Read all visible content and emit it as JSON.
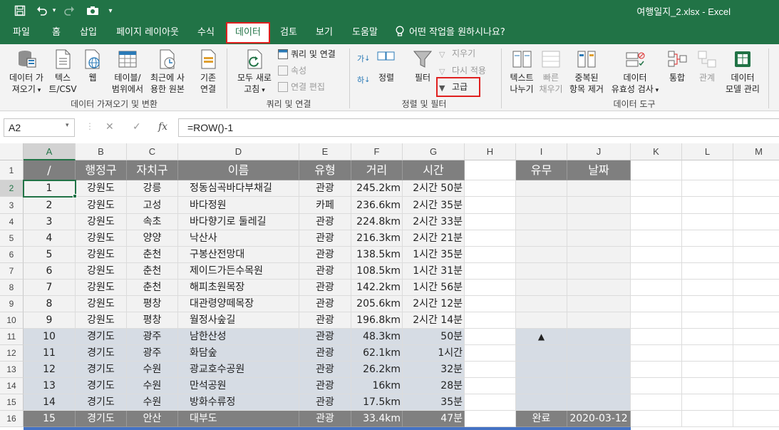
{
  "title_bar": {
    "window_title": "여행일지_2.xlsx  -  Excel"
  },
  "tabs": [
    "파일",
    "홈",
    "삽입",
    "페이지 레이아웃",
    "수식",
    "데이터",
    "검토",
    "보기",
    "도움말"
  ],
  "tell_me": "어떤 작업을 원하시나요?",
  "ribbon": {
    "get_data": {
      "data_btn": [
        "데이터 가",
        "져오기"
      ],
      "text_csv": [
        "텍스",
        "트/CSV"
      ],
      "web": "웹",
      "from_table": [
        "테이블/",
        "범위에서"
      ],
      "recent": [
        "최근에 사",
        "용한 원본"
      ],
      "existing": [
        "기존",
        "연결"
      ],
      "group": "데이터 가져오기 및 변환"
    },
    "queries": {
      "refresh": [
        "모두 새로",
        "고침"
      ],
      "queries_conn": "쿼리 및 연결",
      "properties": "속성",
      "edit_links": "연결 편집",
      "group": "쿼리 및 연결"
    },
    "sort_filter": {
      "sort": "정렬",
      "filter": "필터",
      "clear": "지우기",
      "reapply": "다시 적용",
      "advanced": "고급",
      "group": "정렬 및 필터",
      "az": "가",
      "za": "하"
    },
    "data_tools": {
      "text_to_cols": [
        "텍스트",
        "나누기"
      ],
      "flash_fill": [
        "빠른",
        "채우기"
      ],
      "remove_dup": [
        "중복된",
        "항목 제거"
      ],
      "validation": [
        "데이터",
        "유효성 검사"
      ],
      "consolidate": "통합",
      "relationships": "관계",
      "data_model": [
        "데이터",
        "모델 관리"
      ],
      "group": "데이터 도구"
    }
  },
  "formula_bar": {
    "name_box": "A2",
    "formula": "=ROW()-1",
    "fx": "fx"
  },
  "columns": [
    "A",
    "B",
    "C",
    "D",
    "E",
    "F",
    "G",
    "H",
    "I",
    "J",
    "K",
    "L",
    "M"
  ],
  "header_row": [
    "/",
    "행정구",
    "자치구",
    "이름",
    "유형",
    "거리",
    "시간",
    "",
    "유무",
    "날짜"
  ],
  "rows": [
    [
      "1",
      "강원도",
      "강릉",
      "정동심곡바다부채길",
      "관광",
      "245.2km",
      "2시간 50분",
      "",
      "",
      ""
    ],
    [
      "2",
      "강원도",
      "고성",
      "바다정원",
      "카페",
      "236.6km",
      "2시간 35분",
      "",
      "",
      ""
    ],
    [
      "3",
      "강원도",
      "속초",
      "바다향기로 둘레길",
      "관광",
      "224.8km",
      "2시간 33분",
      "",
      "",
      ""
    ],
    [
      "4",
      "강원도",
      "양양",
      "낙산사",
      "관광",
      "216.3km",
      "2시간 21분",
      "",
      "",
      ""
    ],
    [
      "5",
      "강원도",
      "춘천",
      "구봉산전망대",
      "관광",
      "138.5km",
      "1시간 35분",
      "",
      "",
      ""
    ],
    [
      "6",
      "강원도",
      "춘천",
      "제이드가든수목원",
      "관광",
      "108.5km",
      "1시간 31분",
      "",
      "",
      ""
    ],
    [
      "7",
      "강원도",
      "춘천",
      "해피초원목장",
      "관광",
      "142.2km",
      "1시간 56분",
      "",
      "",
      ""
    ],
    [
      "8",
      "강원도",
      "평창",
      "대관령양떼목장",
      "관광",
      "205.6km",
      "2시간 12분",
      "",
      "",
      ""
    ],
    [
      "9",
      "강원도",
      "평창",
      "월정사숲길",
      "관광",
      "196.8km",
      "2시간 14분",
      "",
      "",
      ""
    ],
    [
      "10",
      "경기도",
      "광주",
      "남한산성",
      "관광",
      "48.3km",
      "50분",
      "",
      "▲",
      ""
    ],
    [
      "11",
      "경기도",
      "광주",
      "화담숲",
      "관광",
      "62.1km",
      "1시간",
      "",
      "",
      ""
    ],
    [
      "12",
      "경기도",
      "수원",
      "광교호수공원",
      "관광",
      "26.2km",
      "32분",
      "",
      "",
      ""
    ],
    [
      "13",
      "경기도",
      "수원",
      "만석공원",
      "관광",
      "16km",
      "28분",
      "",
      "",
      ""
    ],
    [
      "14",
      "경기도",
      "수원",
      "방화수류정",
      "관광",
      "17.5km",
      "35분",
      "",
      "",
      ""
    ],
    [
      "15",
      "경기도",
      "안산",
      "대부도",
      "관광",
      "33.4km",
      "47분",
      "",
      "완료",
      "2020-03-12"
    ]
  ],
  "row_numbers": [
    "1",
    "2",
    "3",
    "4",
    "5",
    "6",
    "7",
    "8",
    "9",
    "10",
    "11",
    "12",
    "13",
    "14",
    "15",
    "16"
  ],
  "colors": {
    "excel_green": "#217346",
    "highlight_red": "#e0201f",
    "header_gray": "#7f7f7f",
    "blue_band": "#d6dce4"
  }
}
